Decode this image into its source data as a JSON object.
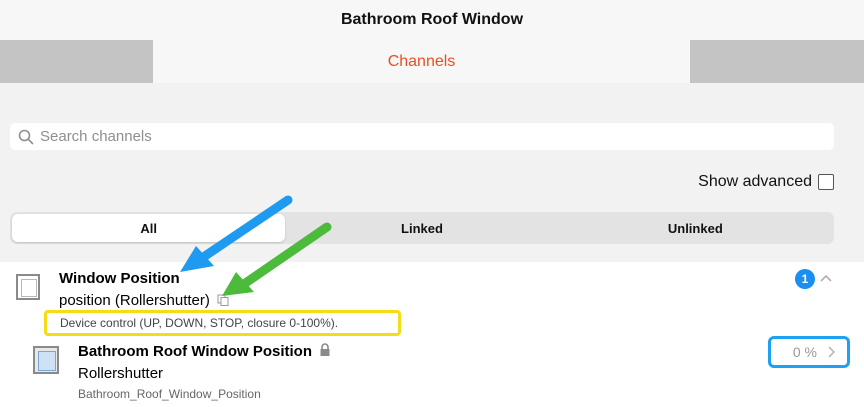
{
  "window": {
    "title": "Bathroom Roof Window"
  },
  "tabs": {
    "active_label": "Channels"
  },
  "search": {
    "placeholder": "Search channels"
  },
  "show_advanced": {
    "label": "Show advanced",
    "checked": false
  },
  "filters": [
    "All",
    "Linked",
    "Unlinked"
  ],
  "channel": {
    "title": "Window Position",
    "subtitle": "position (Rollershutter)",
    "description": "Device control (UP, DOWN, STOP, closure 0-100%).",
    "link_count": "1"
  },
  "linked_item": {
    "title": "Bathroom Roof Window Position",
    "type": "Rollershutter",
    "uid": "Bathroom_Roof_Window_Position",
    "state": "0 %"
  },
  "colors": {
    "accent": "#e8501f",
    "badge": "#1a8ff0",
    "highlight_yellow": "#f4dc16",
    "highlight_blue": "#1da1f2",
    "arrow_blue": "#1e9bf0",
    "arrow_green": "#4cbb3c"
  }
}
